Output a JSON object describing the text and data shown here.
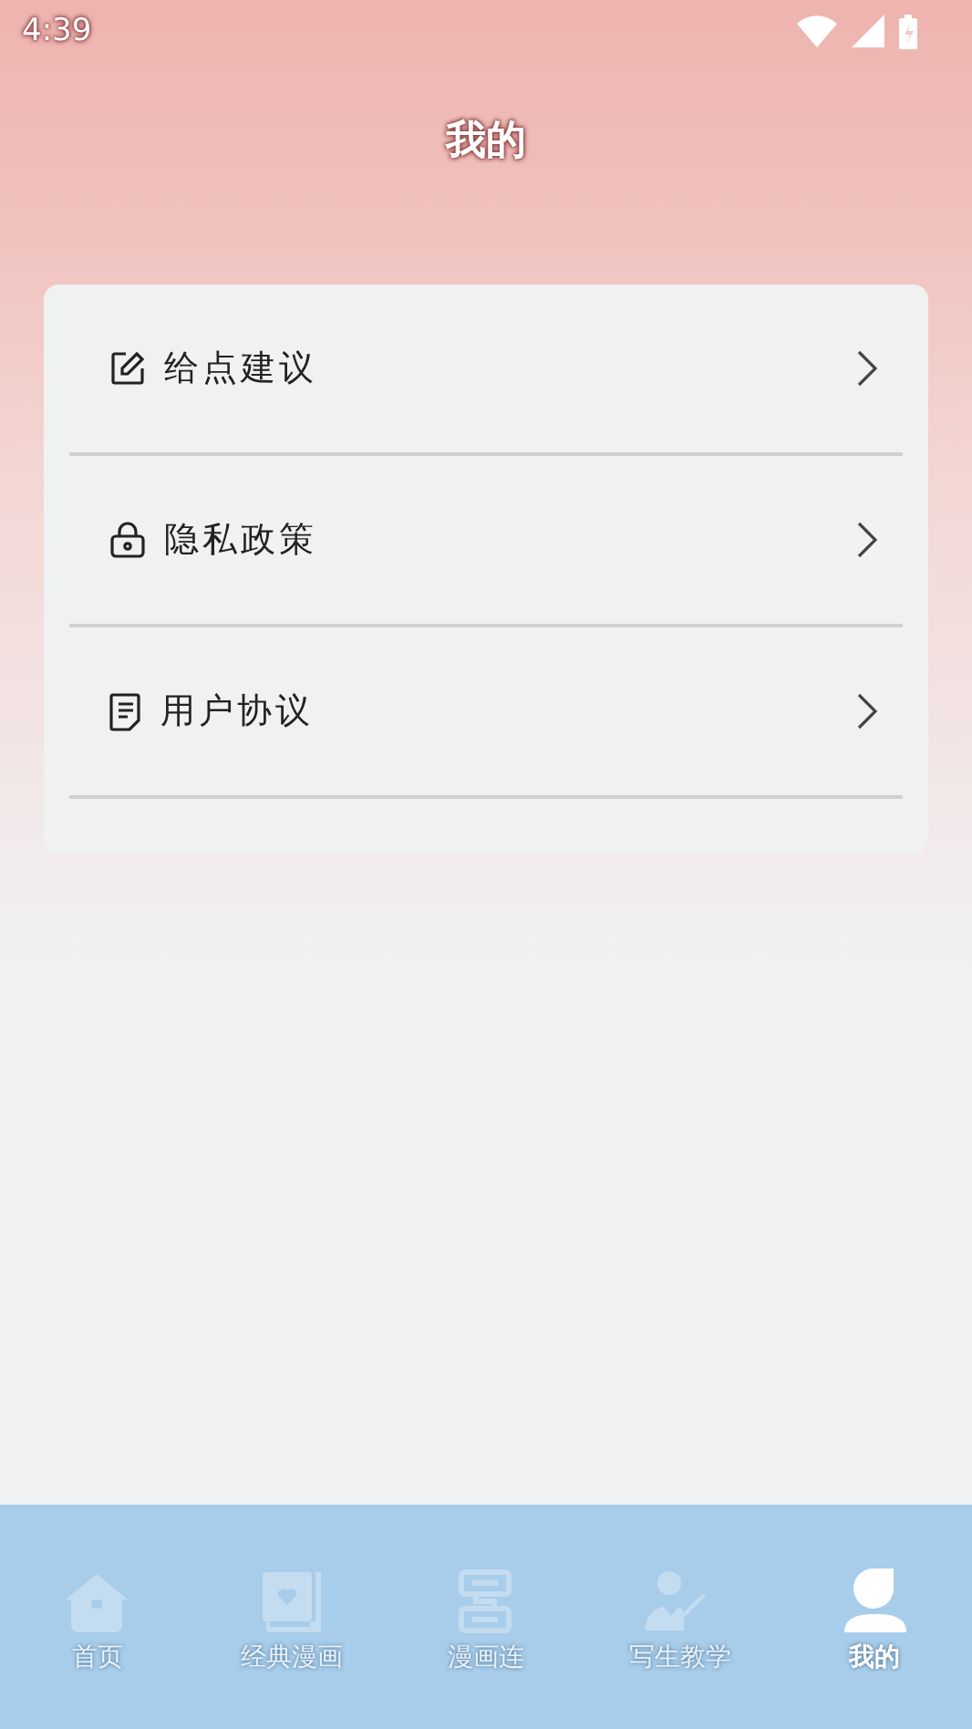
{
  "status_bar": {
    "time": "4:39"
  },
  "header": {
    "title": "我的"
  },
  "menu": [
    {
      "label": "给点建议"
    },
    {
      "label": "隐私政策"
    },
    {
      "label": "用户协议"
    }
  ],
  "tab_bar": [
    {
      "label": "首页",
      "selected": false
    },
    {
      "label": "经典漫画",
      "selected": false
    },
    {
      "label": "漫画连",
      "selected": false
    },
    {
      "label": "写生教学",
      "selected": false
    },
    {
      "label": "我的",
      "selected": true
    }
  ]
}
